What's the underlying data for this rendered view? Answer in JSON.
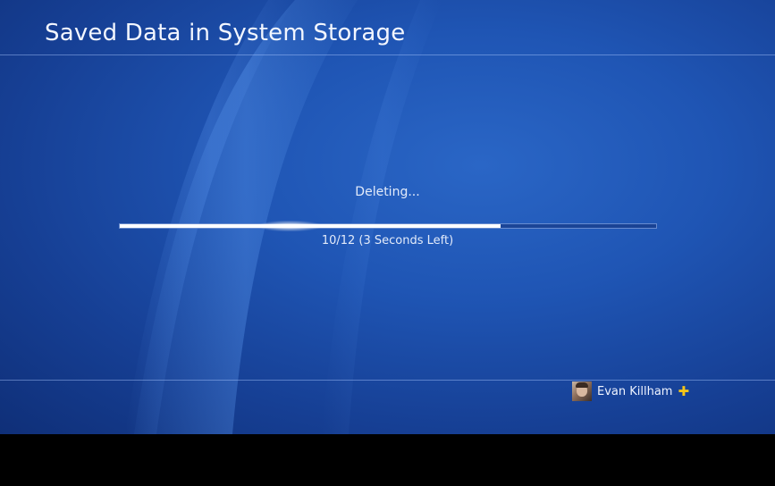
{
  "header": {
    "title": "Saved Data in System Storage"
  },
  "operation": {
    "status": "Deleting...",
    "progress_text": "10/12 (3 Seconds Left)",
    "progress_fraction": 0.71
  },
  "user": {
    "name": "Evan Killham",
    "badge_icon": "playstation-plus-icon",
    "badge_glyph": "✚"
  },
  "colors": {
    "background": "#1f55b4",
    "progress_fill": "#ffffff",
    "plus_badge": "#f5c518"
  }
}
